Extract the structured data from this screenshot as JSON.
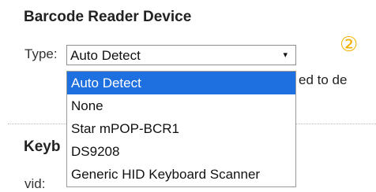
{
  "section": {
    "title": "Barcode Reader Device",
    "type_label": "Type:",
    "selected_value": "Auto Detect",
    "arrow_icon": "▾",
    "step_marker": "②",
    "hint_text": "ed to de"
  },
  "dropdown": {
    "options": [
      "Auto Detect",
      "None",
      "Star mPOP-BCR1",
      "DS9208",
      "Generic HID Keyboard Scanner"
    ],
    "selected_index": 0,
    "highlight_color": "#1e6fe0"
  },
  "keyboard": {
    "title": "Keyb",
    "vid_label": "vid:"
  }
}
